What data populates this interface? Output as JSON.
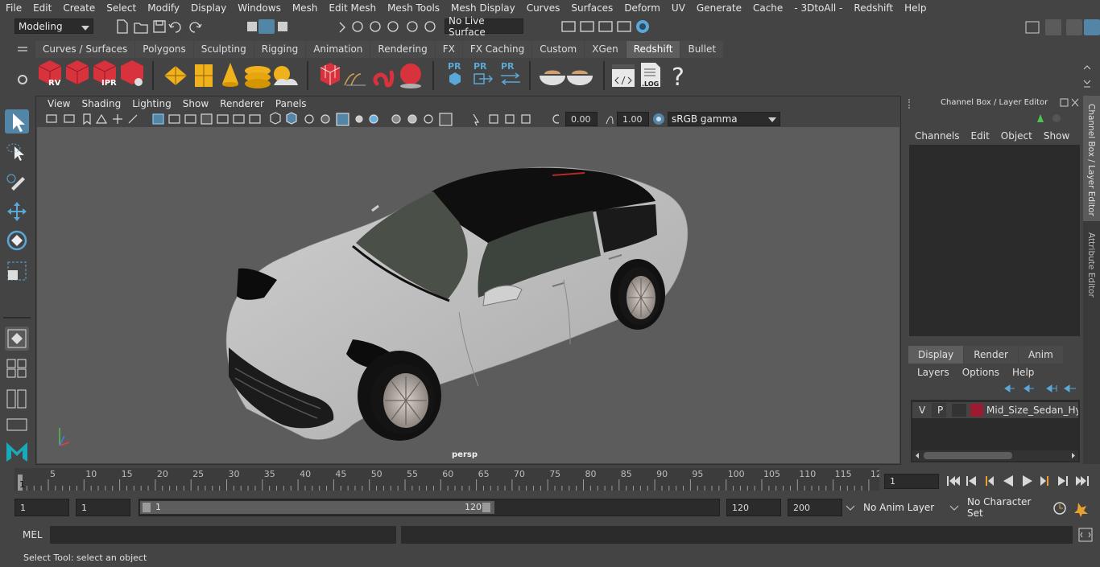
{
  "menubar": {
    "items": [
      "File",
      "Edit",
      "Create",
      "Select",
      "Modify",
      "Display",
      "Windows",
      "Mesh",
      "Edit Mesh",
      "Mesh Tools",
      "Mesh Display",
      "Curves",
      "Surfaces",
      "Deform",
      "UV",
      "Generate",
      "Cache",
      "- 3DtoAll -",
      "Redshift",
      "Help"
    ]
  },
  "status_line": {
    "mode": "Modeling",
    "live_surface": "No Live Surface"
  },
  "shelf": {
    "tabs": [
      "Curves / Surfaces",
      "Polygons",
      "Sculpting",
      "Rigging",
      "Animation",
      "Rendering",
      "FX",
      "FX Caching",
      "Custom",
      "XGen",
      "Redshift",
      "Bullet"
    ],
    "active_tab": "Redshift",
    "icon_labels": {
      "rv": "RV",
      "ipr": "IPR",
      "pr": "PR",
      "log": ".LOG",
      "help": "?"
    }
  },
  "viewport": {
    "menu": [
      "View",
      "Shading",
      "Lighting",
      "Show",
      "Renderer",
      "Panels"
    ],
    "exposure": "0.00",
    "gamma": "1.00",
    "color_space": "sRGB gamma",
    "camera_label": "persp"
  },
  "channel_box": {
    "title": "Channel Box / Layer Editor",
    "menu": [
      "Channels",
      "Edit",
      "Object",
      "Show"
    ]
  },
  "layer_editor": {
    "tabs": [
      "Display",
      "Render",
      "Anim"
    ],
    "active_tab": "Display",
    "menu": [
      "Layers",
      "Options",
      "Help"
    ],
    "layer": {
      "v": "V",
      "p": "P",
      "name": "Mid_Size_Sedan_Hydro",
      "color": "#9b1b30"
    }
  },
  "side_tabs": [
    "Channel Box / Layer Editor",
    "Attribute Editor"
  ],
  "timeline": {
    "ticks": [
      "5",
      "10",
      "15",
      "20",
      "25",
      "30",
      "35",
      "40",
      "45",
      "50",
      "55",
      "60",
      "65",
      "70",
      "75",
      "80",
      "85",
      "90",
      "95",
      "100",
      "105",
      "110",
      "115",
      "12"
    ],
    "current_marker": "1",
    "current_frame": "1"
  },
  "range": {
    "start": "1",
    "playback_start": "1",
    "slider_start": "1",
    "slider_end": "120",
    "playback_end": "120",
    "end": "200",
    "anim_layer": "No Anim Layer",
    "character_set": "No Character Set"
  },
  "command_line": {
    "label": "MEL"
  },
  "help_line": {
    "text": "Select Tool: select an object"
  },
  "colors": {
    "accent": "#5285a6",
    "redshift_red": "#d8323c",
    "shelf_yellow": "#f0b21c"
  }
}
